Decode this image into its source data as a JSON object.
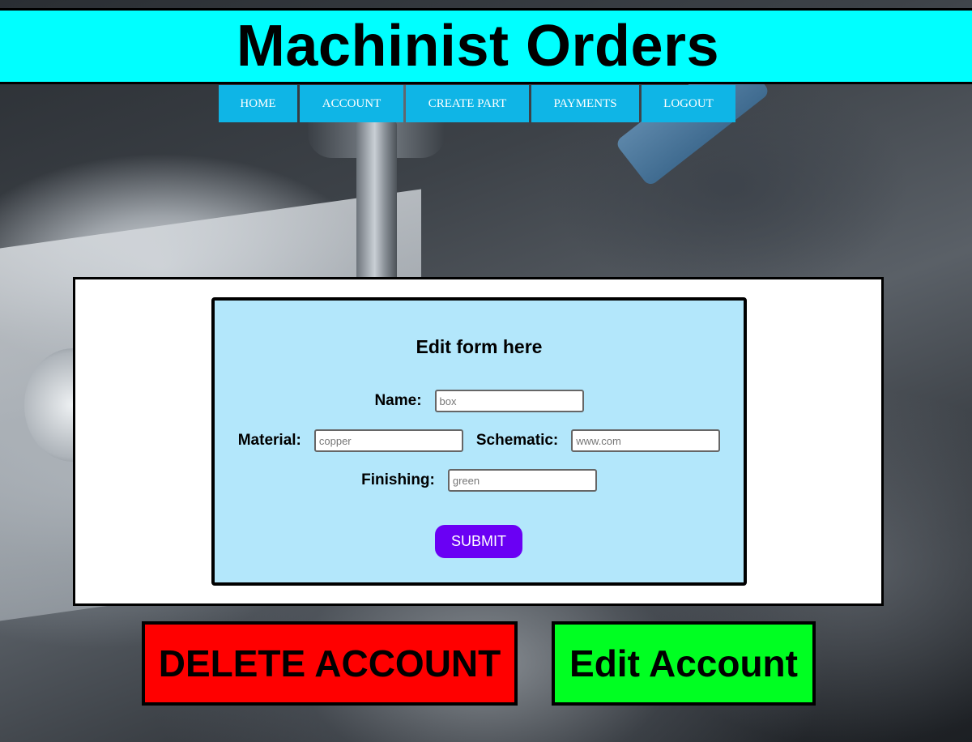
{
  "header": {
    "title": "Machinist Orders"
  },
  "nav": {
    "items": [
      {
        "label": "HOME"
      },
      {
        "label": "ACCOUNT"
      },
      {
        "label": "CREATE PART"
      },
      {
        "label": "PAYMENTS"
      },
      {
        "label": "LOGOUT"
      }
    ]
  },
  "form": {
    "title": "Edit form here",
    "name": {
      "label": "Name:",
      "placeholder": "box",
      "value": ""
    },
    "material": {
      "label": "Material:",
      "placeholder": "copper",
      "value": ""
    },
    "schematic": {
      "label": "Schematic:",
      "placeholder": "www.com",
      "value": ""
    },
    "finishing": {
      "label": "Finishing:",
      "placeholder": "green",
      "value": ""
    },
    "submit_label": "SUBMIT"
  },
  "actions": {
    "delete_label": "DELETE ACCOUNT",
    "edit_label": "Edit Account"
  },
  "colors": {
    "header_bg": "#00ffff",
    "nav_bg": "#0fb5e6",
    "form_bg": "#b3e7fb",
    "submit_bg": "#6a00f4",
    "delete_bg": "#ff0000",
    "edit_bg": "#00ff22"
  }
}
